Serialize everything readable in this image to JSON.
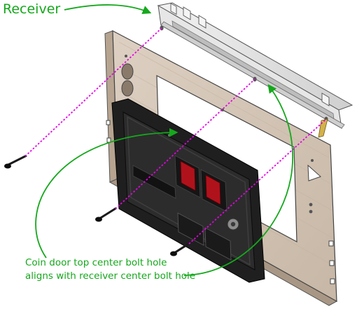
{
  "labels": {
    "receiver": "Receiver",
    "callout_line1": "Coin door top center bolt hole",
    "callout_line2": "aligns with receiver center bolt hole"
  },
  "colors": {
    "callout_green": "#15a81c",
    "alignment_magenta": "#e800e8",
    "panel_wood": "#d8cbbd",
    "door_dark": "#1f1f1f",
    "coin_slot_red": "#b0121c",
    "receiver_metal": "#dedede"
  }
}
